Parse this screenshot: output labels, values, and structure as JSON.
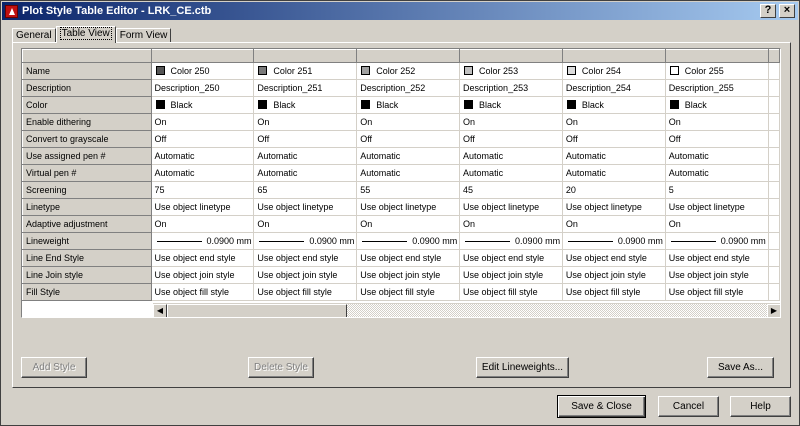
{
  "window": {
    "title": "Plot Style Table Editor - LRK_CE.ctb"
  },
  "tabs": [
    {
      "label": "General"
    },
    {
      "label": "Table View"
    },
    {
      "label": "Form View"
    }
  ],
  "grid": {
    "row_labels": [
      "Name",
      "Description",
      "Color",
      "Enable dithering",
      "Convert to grayscale",
      "Use assigned pen #",
      "Virtual pen #",
      "Screening",
      "Linetype",
      "Adaptive adjustment",
      "Lineweight",
      "Line End Style",
      "Line Join style",
      "Fill Style"
    ],
    "columns": [
      {
        "swatch": "#555555",
        "name": "Color 250",
        "description": "Description_250",
        "color_swatch": "#000000",
        "color": "Black",
        "dithering": "On",
        "grayscale": "Off",
        "assigned_pen": "Automatic",
        "virtual_pen": "Automatic",
        "screening": "75",
        "linetype": "Use object linetype",
        "adaptive": "On",
        "lineweight": "0.0900 mm",
        "end_style": "Use object end style",
        "join_style": "Use object join style",
        "fill_style": "Use object fill style"
      },
      {
        "swatch": "#7a7a7a",
        "name": "Color 251",
        "description": "Description_251",
        "color_swatch": "#000000",
        "color": "Black",
        "dithering": "On",
        "grayscale": "Off",
        "assigned_pen": "Automatic",
        "virtual_pen": "Automatic",
        "screening": "65",
        "linetype": "Use object linetype",
        "adaptive": "On",
        "lineweight": "0.0900 mm",
        "end_style": "Use object end style",
        "join_style": "Use object join style",
        "fill_style": "Use object fill style"
      },
      {
        "swatch": "#a0a0a0",
        "name": "Color 252",
        "description": "Description_252",
        "color_swatch": "#000000",
        "color": "Black",
        "dithering": "On",
        "grayscale": "Off",
        "assigned_pen": "Automatic",
        "virtual_pen": "Automatic",
        "screening": "55",
        "linetype": "Use object linetype",
        "adaptive": "On",
        "lineweight": "0.0900 mm",
        "end_style": "Use object end style",
        "join_style": "Use object join style",
        "fill_style": "Use object fill style"
      },
      {
        "swatch": "#c0c0c0",
        "name": "Color 253",
        "description": "Description_253",
        "color_swatch": "#000000",
        "color": "Black",
        "dithering": "On",
        "grayscale": "Off",
        "assigned_pen": "Automatic",
        "virtual_pen": "Automatic",
        "screening": "45",
        "linetype": "Use object linetype",
        "adaptive": "On",
        "lineweight": "0.0900 mm",
        "end_style": "Use object end style",
        "join_style": "Use object join style",
        "fill_style": "Use object fill style"
      },
      {
        "swatch": "#dcdcdc",
        "name": "Color 254",
        "description": "Description_254",
        "color_swatch": "#000000",
        "color": "Black",
        "dithering": "On",
        "grayscale": "Off",
        "assigned_pen": "Automatic",
        "virtual_pen": "Automatic",
        "screening": "20",
        "linetype": "Use object linetype",
        "adaptive": "On",
        "lineweight": "0.0900 mm",
        "end_style": "Use object end style",
        "join_style": "Use object join style",
        "fill_style": "Use object fill style"
      },
      {
        "swatch": "#ffffff",
        "name": "Color 255",
        "description": "Description_255",
        "color_swatch": "#000000",
        "color": "Black",
        "dithering": "On",
        "grayscale": "Off",
        "assigned_pen": "Automatic",
        "virtual_pen": "Automatic",
        "screening": "5",
        "linetype": "Use object linetype",
        "adaptive": "On",
        "lineweight": "0.0900 mm",
        "end_style": "Use object end style",
        "join_style": "Use object join style",
        "fill_style": "Use object fill style"
      }
    ]
  },
  "buttons": {
    "add_style": "Add Style",
    "delete_style": "Delete Style",
    "edit_lineweights": "Edit Lineweights...",
    "save_as": "Save As...",
    "save_close": "Save & Close",
    "cancel": "Cancel",
    "help": "Help"
  },
  "title_buttons": {
    "help": "?",
    "close": "×"
  }
}
